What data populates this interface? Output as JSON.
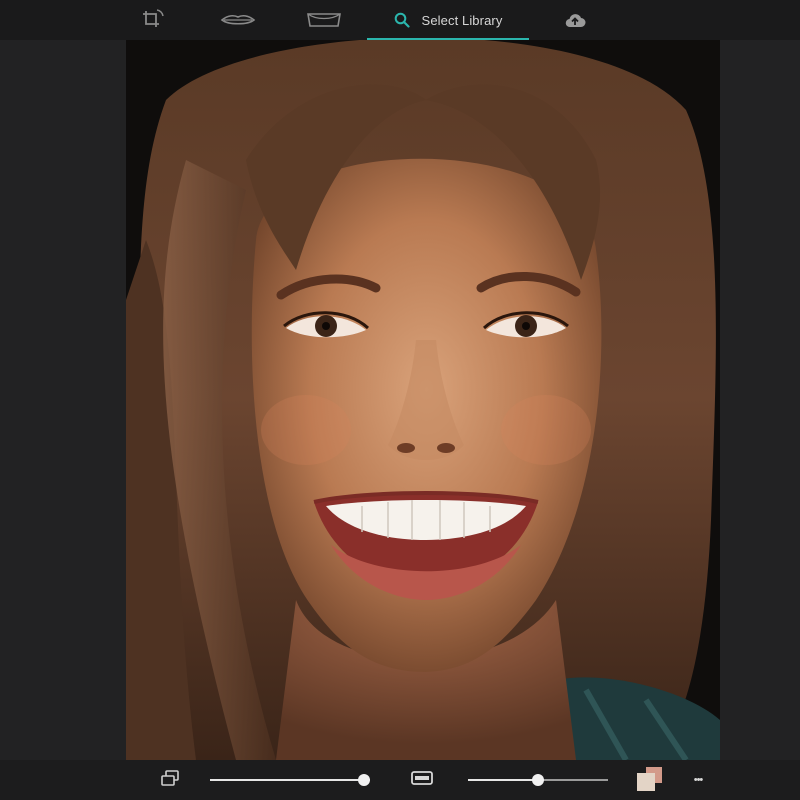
{
  "toolbar": {
    "tools": [
      {
        "name": "rotate-tool",
        "icon": "rotate-crop-icon"
      },
      {
        "name": "lip-outline-tool",
        "icon": "lip-outline-icon"
      },
      {
        "name": "smile-frame-tool",
        "icon": "smile-frame-icon"
      }
    ],
    "library_tab": {
      "label": "Select Library",
      "icon": "search-icon",
      "active": true
    },
    "upload": {
      "icon": "cloud-upload-icon"
    }
  },
  "canvas": {
    "image": "portrait-photo",
    "description_icon": "face-photo"
  },
  "bottom": {
    "layers": {
      "icon": "layers-icon"
    },
    "opacity_slider": {
      "value": 0.96
    },
    "frame_toggle": {
      "icon": "rectangle-icon"
    },
    "size_slider": {
      "value": 0.5
    },
    "color_swatch": {
      "icon": "color-swatch-icon",
      "front": "#e3d4c6",
      "back": "#d39a8a"
    },
    "more": {
      "label": "•••",
      "icon": "more-icon"
    }
  },
  "colors": {
    "accent": "#2bb6ad",
    "bar": "#1a1a1b",
    "side": "#222223"
  }
}
